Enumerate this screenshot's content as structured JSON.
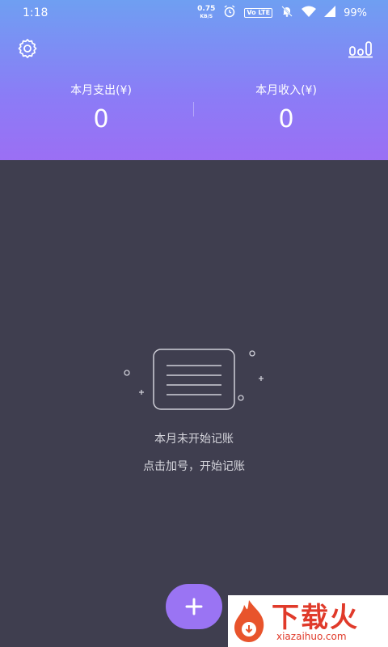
{
  "status_bar": {
    "time": "1:18",
    "net_speed_value": "0.75",
    "net_speed_unit": "KB/S",
    "volte": "Vo LTE",
    "battery": "99%"
  },
  "header": {
    "expense_label": "本月支出(¥)",
    "expense_value": "0",
    "income_label": "本月收入(¥)",
    "income_value": "0",
    "gradient_colors": [
      "#6f9ff2",
      "#9b6ff4"
    ]
  },
  "empty_state": {
    "title": "本月未开始记账",
    "hint": "点击加号，开始记账"
  },
  "fab": {
    "label": "+",
    "color": "#9a74f3"
  },
  "watermark": {
    "text": "下载火",
    "url": "xiazaihuo.com"
  },
  "icons": {
    "settings": "gear-icon",
    "stats": "bar-chart-icon",
    "alarm": "alarm-icon",
    "mute": "bell-off-icon",
    "wifi": "wifi-icon",
    "signal": "signal-icon",
    "battery": "battery-icon"
  }
}
